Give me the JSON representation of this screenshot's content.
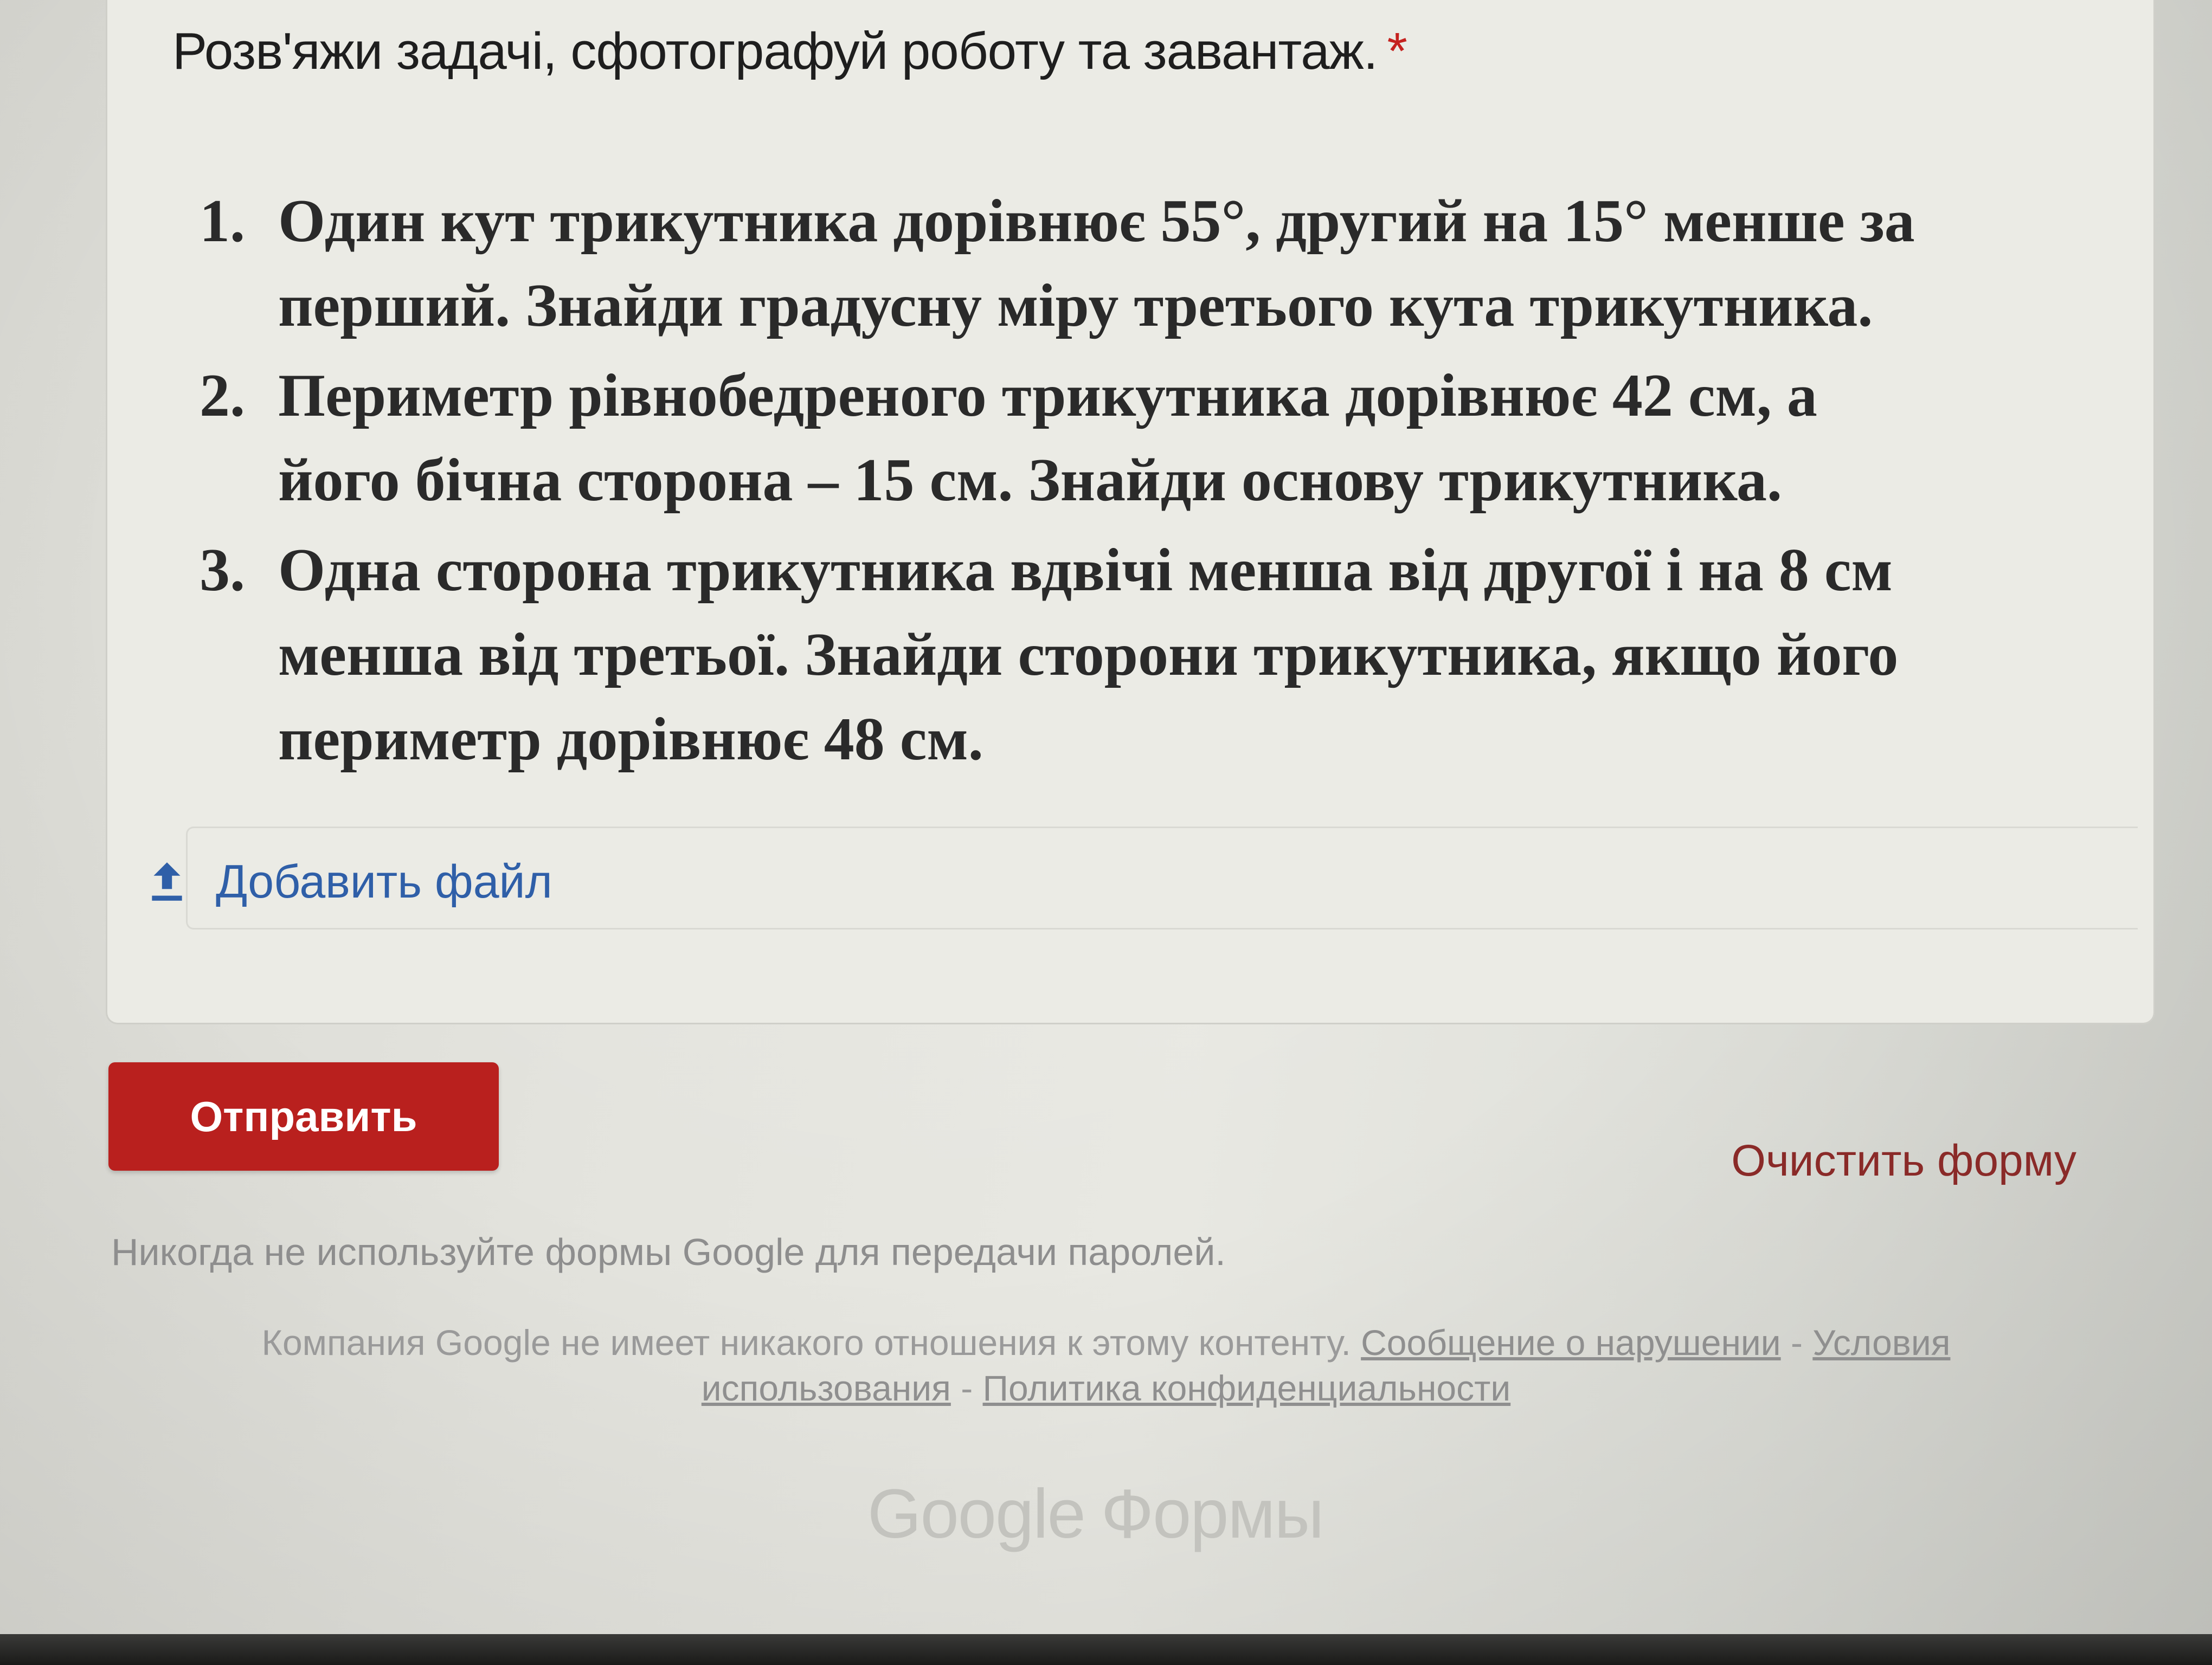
{
  "question": {
    "title": "Розв'яжи задачі, сфотографуй роботу та завантаж.",
    "required_mark": "*"
  },
  "tasks": [
    {
      "num": "1.",
      "line1": "Один кут трикутника дорівнює 55°,  другий на 15° менше за",
      "line2": "перший. Знайди градусну міру третього кута трикутника."
    },
    {
      "num": "2.",
      "line1": "Периметр рівнобедреного трикутника дорівнює 42 см, а",
      "line2": "його бічна сторона – 15 см. Знайди основу трикутника."
    },
    {
      "num": "3.",
      "line1": "Одна сторона трикутника вдвічі менша від другої і на 8 см",
      "line2": "менша від третьої. Знайди сторони трикутника, якщо його",
      "line3": "периметр дорівнює 48 см."
    }
  ],
  "upload": {
    "label": "Добавить файл",
    "icon": "upload-icon"
  },
  "actions": {
    "submit_label": "Отправить",
    "clear_label": "Очистить форму"
  },
  "footer": {
    "password_note": "Никогда не используйте формы Google для передачи паролей.",
    "disclaimer_text": "Компания Google не имеет никакого отношения к этому контенту.",
    "report_link": "Сообщение о нарушении",
    "separator": "-",
    "terms_link": "Условия использования",
    "privacy_link": "Политика конфиденциальности",
    "brand_google": "Google",
    "brand_product": "Формы"
  },
  "colors": {
    "submit": "#b9201e",
    "link": "#2f5fa8",
    "required": "#c5221f",
    "clear": "#8a2a28"
  }
}
